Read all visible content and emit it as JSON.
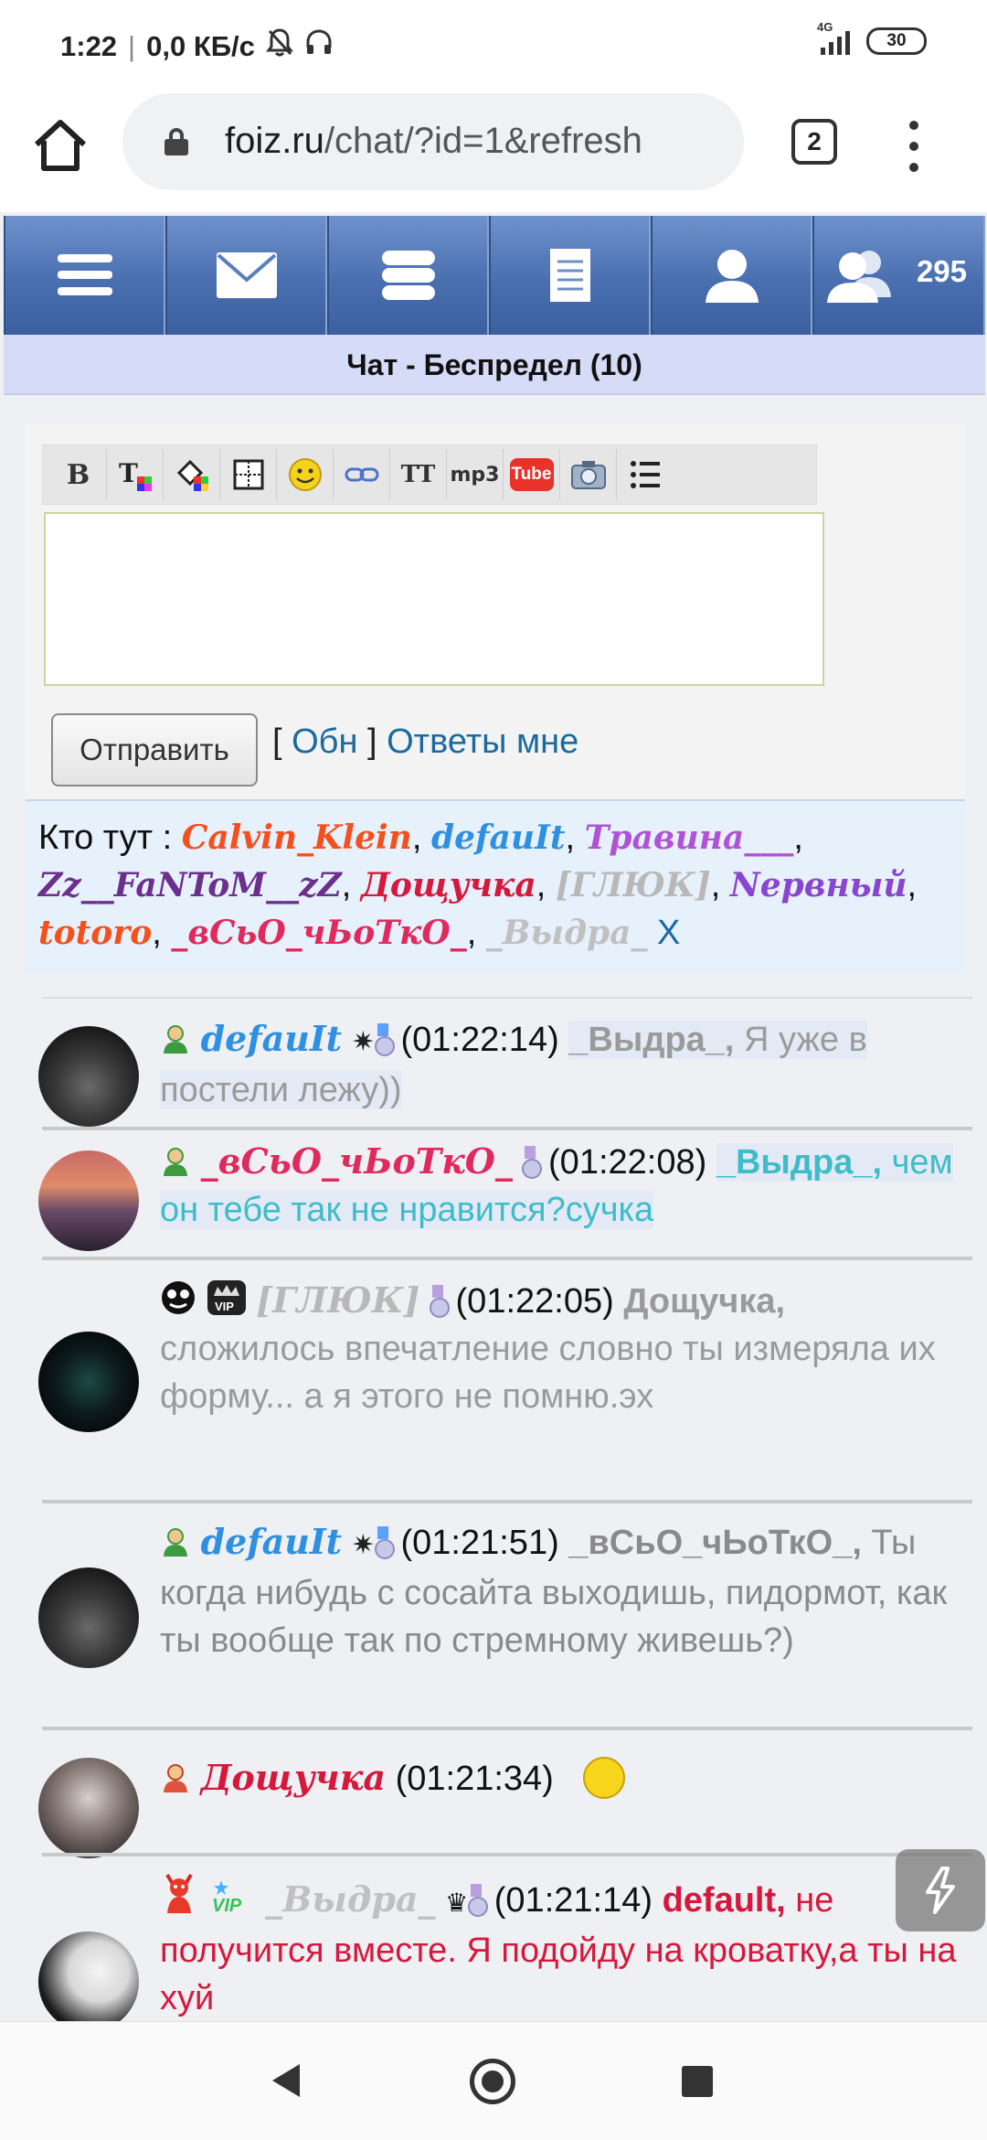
{
  "status_bar": {
    "time": "1:22",
    "net_speed": "0,0 КБ/с",
    "icons": [
      "bell-off-icon",
      "headphones-icon"
    ],
    "network_type": "4G",
    "battery": "30"
  },
  "browser": {
    "url_host": "foiz.ru",
    "url_path": "/chat/?id=1&refresh",
    "tab_count": "2"
  },
  "nav": {
    "items": [
      "menu-icon",
      "mail-icon",
      "forum-icon",
      "notes-icon",
      "profile-icon",
      "users-icon"
    ],
    "online_count": "295"
  },
  "chat_title": "Чат - Беспредел (10)",
  "editor": {
    "tools": [
      "B",
      "Tx",
      "fill",
      "table",
      "smiley",
      "link",
      "TT",
      "mp3",
      "Tube",
      "photo",
      "list"
    ],
    "message_value": "",
    "send_label": "Отправить",
    "refresh_link": "Обн",
    "bracket_open": "[",
    "bracket_close": "]",
    "replies_link": "Ответы мне"
  },
  "online": {
    "label": "Кто тут :",
    "users": [
      {
        "name": "Calvin_Klein",
        "color": "#f4501e"
      },
      {
        "name": "defauIt",
        "color": "#2f8fe0"
      },
      {
        "name": "Травина___",
        "color": "#b052d6"
      },
      {
        "name": "Zz__FaNToM__zZ",
        "color": "#6b2f8c"
      },
      {
        "name": "Дощучка",
        "color": "#d6183c"
      },
      {
        "name": "[ГЛЮК]",
        "color": "#b8b8b8"
      },
      {
        "name": "Nервный",
        "color": "#8a45d0"
      },
      {
        "name": "totoro",
        "color": "#f4501e"
      },
      {
        "name": "_вСьО_чЬоТкО_",
        "color": "#e02a5e"
      },
      {
        "name": "_Выдра_",
        "color": "#c0c0c0"
      }
    ],
    "close": "X"
  },
  "messages": [
    {
      "user": "defauIt",
      "user_color": "#2f8fe0",
      "time": "(01:22:14)",
      "to": "_Выдра_,",
      "to_color": "#9a9a9a",
      "text": "Я уже в постели лежу))",
      "text_color": "#9a9a9a"
    },
    {
      "user": "_вСьО_чЬоТкО_",
      "user_color": "#e02a5e",
      "time": "(01:22:08)",
      "to": "_Выдра_,",
      "to_color": "#3fbcc9",
      "text": "чем он тебе так не нравится?сучка",
      "text_color": "#3fbcc9"
    },
    {
      "user": "[ГЛЮК]",
      "user_color": "#b8b8b8",
      "time": "(01:22:05)",
      "to": "Дощучка,",
      "to_color": "#9a9a9a",
      "text": "сложилось впечатление словно ты измеряла их форму... а я этого не помню.эх",
      "text_color": "#9a9a9a"
    },
    {
      "user": "defauIt",
      "user_color": "#2f8fe0",
      "time": "(01:21:51)",
      "to": "_вСьО_чЬоТкО_,",
      "to_color": "#8a8a8a",
      "text": "Ты когда нибудь с сосайта выходишь, пидормот, как ты вообще так по стремному живешь?)",
      "text_color": "#8a8a8a"
    },
    {
      "user": "Дощучка",
      "user_color": "#d6183c",
      "time": "(01:21:34)",
      "to": "",
      "to_color": "#000",
      "text": "",
      "text_color": "#000"
    },
    {
      "user": "_Выдра_",
      "user_color": "#c0c0c0",
      "time": "(01:21:14)",
      "to": "default,",
      "to_color": "#d6183c",
      "text": "не получится вместе. Я подойду на кроватку,а ты на хуй",
      "text_color": "#d6183c"
    }
  ]
}
